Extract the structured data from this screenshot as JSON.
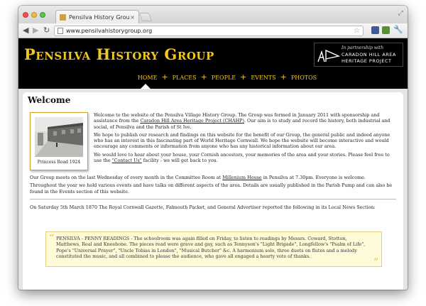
{
  "browser": {
    "tab_title": "Pensilva History Group",
    "tab_close": "×",
    "url": "www.pensilvahistorygroup.org",
    "back": "◀",
    "forward": "▶",
    "reload": "↻",
    "star": "☆",
    "wrench": "🔧",
    "resize": "⤢"
  },
  "header": {
    "site_title": "Pensilva History Group",
    "partner_line1": "In partnership with",
    "partner_line2": "CARADON HILL AREA",
    "partner_line3": "HERITAGE PROJECT"
  },
  "nav": {
    "items": [
      {
        "label": "home"
      },
      {
        "label": "places"
      },
      {
        "label": "people"
      },
      {
        "label": "events"
      },
      {
        "label": "photos"
      }
    ],
    "separator": "+"
  },
  "content": {
    "title": "Welcome",
    "photo_caption": "Princess Road 1924",
    "p1_a": "Welcome to the website of the Pensilva Village History Group. The Group was formed in January 2011 with sponsorship and assistance from the ",
    "p1_link": "Caradon Hill Area Heritage Project (CHAHP)",
    "p1_b": ". Our aim is to study and record the history, both industrial and social, of Pensilva and the Parish of St Ive.",
    "p2": "We hope to publish our research and findings on this website for the benefit of our Group, the general public and indeed anyone who has an interest in this fascinating part of World Heritage Cornwall. We hope the website will become interactive and would encourage any comments or information from anyone who has any historical information about our area.",
    "p3_a": "We would love to hear about your house, your Cornish ancestors, your memories of the area and your stories. Please feel free to use the ",
    "p3_link": "\"Contact Us\"",
    "p3_b": " facility - we will get back to you.",
    "p4_a": "Our Group meets on the last Wednesday of every month in the Committee Room at ",
    "p4_link": "Millenium House",
    "p4_b": " in Pensilva at 7.30pm. Everyone is welcome.",
    "p5": "Throughout the year we hold various events and have talks on different aspects of the area. Details are usually published in the Parish Pump and can also be found in the Events section of this website.",
    "p6": "On Saturday 5th March 1870 The Royal Cornwall Gazette, Falmouth Packet, and General Advertiser reported the following in its Local News Section:",
    "quote": "PENSILVA - PENNY READINGS - The schoolroom was again filled on Friday, to listen to readings by Messrs. Coward, Stotton, Matthews, Real and Kneebone. The pieces read were grave and gay, such as Tennyson's \"Light Brigade\", Longfellow's \"Psalm of Life\", Pope's \"Universal Prayer\", \"Uncle Tobias in London\", \"Musical Butcher\" &c. A harmonium solo, three duets on flutes and a melody constituted the music, and all combined to please the audience, who gave all engaged a hearty vote of thanks.",
    "quote_open": "“",
    "quote_close": "”"
  },
  "colors": {
    "accent_gold": "#f3c81a",
    "header_bg": "#000000",
    "quote_bg": "#fffbd9"
  }
}
